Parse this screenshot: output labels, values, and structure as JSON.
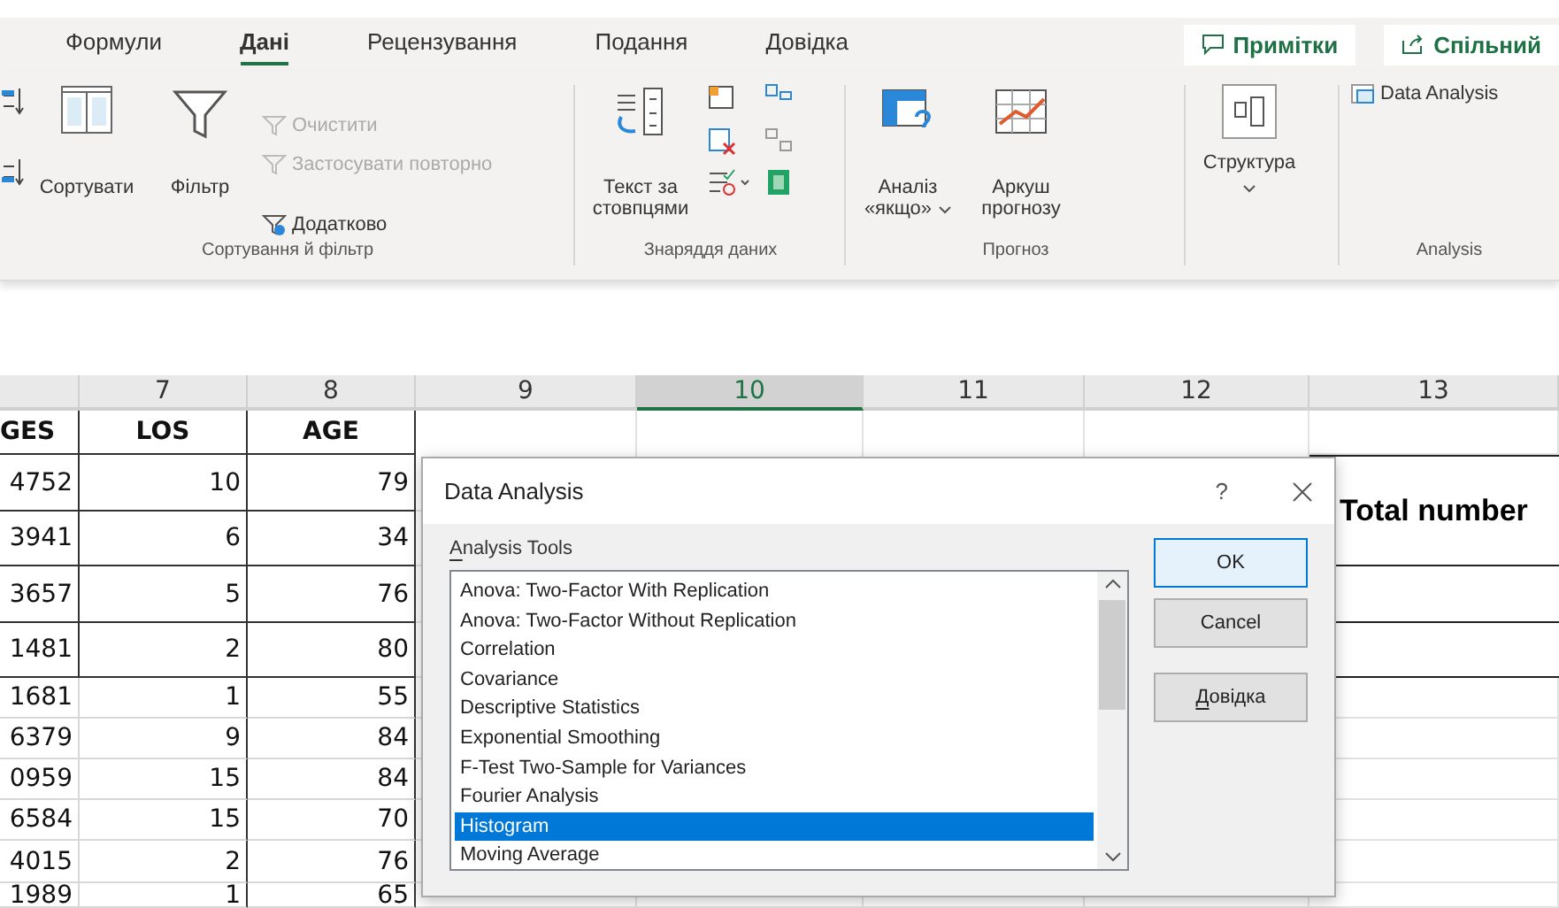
{
  "ribbon": {
    "tabs": [
      {
        "label": "Формули",
        "selected": false
      },
      {
        "label": "Дані",
        "selected": true
      },
      {
        "label": "Рецензування",
        "selected": false
      },
      {
        "label": "Подання",
        "selected": false
      },
      {
        "label": "Довідка",
        "selected": false
      }
    ],
    "actions": [
      {
        "label": "Примітки"
      },
      {
        "label": "Спільний"
      }
    ],
    "groups": [
      {
        "label": "Сортування й фільтр",
        "buttons": [
          {
            "label": "Сортувати",
            "kind": "large",
            "disabled": false,
            "dropdown": false
          },
          {
            "label": "Фільтр",
            "kind": "large",
            "disabled": false,
            "dropdown": false
          },
          {
            "label": "Очистити",
            "kind": "small",
            "disabled": true,
            "dropdown": false
          },
          {
            "label": "Застосувати повторно",
            "kind": "small",
            "disabled": true,
            "dropdown": false
          },
          {
            "label": "Додатково",
            "kind": "small",
            "disabled": false,
            "dropdown": false
          }
        ]
      },
      {
        "label": "Знаряддя даних",
        "buttons": [
          {
            "label": "Текст за стовпцями",
            "kind": "large",
            "disabled": false,
            "dropdown": false
          }
        ]
      },
      {
        "label": "Прогноз",
        "buttons": [
          {
            "label": "Аналіз «якщо»",
            "kind": "large",
            "disabled": false,
            "dropdown": true
          },
          {
            "label": "Аркуш прогнозу",
            "kind": "large",
            "disabled": false,
            "dropdown": false
          }
        ]
      },
      {
        "buttons": [
          {
            "label": "Структура",
            "kind": "large",
            "disabled": false,
            "dropdown": true
          }
        ]
      },
      {
        "label": "Analysis",
        "buttons": [
          {
            "label": "Data Analysis",
            "kind": "small",
            "disabled": false,
            "dropdown": false
          }
        ]
      }
    ]
  },
  "sheet": {
    "columns": [
      {
        "label": "7",
        "selected": false
      },
      {
        "label": "8",
        "selected": false
      },
      {
        "label": "9",
        "selected": false
      },
      {
        "label": "10",
        "selected": true
      },
      {
        "label": "11",
        "selected": false
      },
      {
        "label": "12",
        "selected": false
      },
      {
        "label": "13",
        "selected": false
      }
    ],
    "rows": [
      {
        "kind": "header",
        "bordered": true,
        "cells": [
          "GES",
          "LOS",
          "AGE"
        ]
      },
      {
        "kind": "data",
        "bordered": true,
        "cells": [
          "4752",
          "10",
          "79"
        ]
      },
      {
        "kind": "data",
        "bordered": true,
        "cells": [
          "3941",
          "6",
          "34"
        ]
      },
      {
        "kind": "data",
        "bordered": true,
        "cells": [
          "3657",
          "5",
          "76"
        ]
      },
      {
        "kind": "data",
        "bordered": true,
        "cells": [
          "1481",
          "2",
          "80"
        ]
      },
      {
        "kind": "data",
        "bordered": false,
        "cells": [
          "1681",
          "1",
          "55"
        ]
      },
      {
        "kind": "data",
        "bordered": false,
        "cells": [
          "6379",
          "9",
          "84"
        ]
      },
      {
        "kind": "data",
        "bordered": false,
        "cells": [
          "0959",
          "15",
          "84"
        ]
      },
      {
        "kind": "data",
        "bordered": false,
        "cells": [
          "6584",
          "15",
          "70"
        ]
      },
      {
        "kind": "data",
        "bordered": false,
        "cells": [
          "4015",
          "2",
          "76"
        ]
      },
      {
        "kind": "data",
        "bordered": false,
        "cells": [
          "1989",
          "1",
          "65"
        ]
      }
    ],
    "summary_header": "Total number"
  },
  "dialog": {
    "title": "Data Analysis",
    "help": "?",
    "list_label": "Analysis Tools",
    "list_label_access_key": true,
    "items": [
      {
        "label": "Anova: Two-Factor With Replication",
        "selected": false
      },
      {
        "label": "Anova: Two-Factor Without Replication",
        "selected": false
      },
      {
        "label": "Correlation",
        "selected": false
      },
      {
        "label": "Covariance",
        "selected": false
      },
      {
        "label": "Descriptive Statistics",
        "selected": false
      },
      {
        "label": "Exponential Smoothing",
        "selected": false
      },
      {
        "label": "F-Test Two-Sample for Variances",
        "selected": false
      },
      {
        "label": "Fourier Analysis",
        "selected": false
      },
      {
        "label": "Histogram",
        "selected": true
      },
      {
        "label": "Moving Average",
        "selected": false
      }
    ],
    "buttons": [
      {
        "label": "OK",
        "default": true,
        "access_key": false
      },
      {
        "label": "Cancel",
        "default": false,
        "access_key": false
      },
      {
        "label": "Довідка",
        "default": false,
        "access_key": true
      }
    ]
  }
}
